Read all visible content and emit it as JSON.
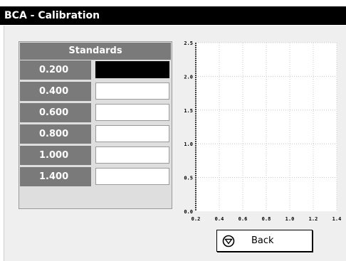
{
  "window": {
    "title": "BCA - Calibration"
  },
  "standards": {
    "header": "Standards",
    "rows": [
      {
        "label": "0.200",
        "value": "",
        "selected": true
      },
      {
        "label": "0.400",
        "value": "",
        "selected": false
      },
      {
        "label": "0.600",
        "value": "",
        "selected": false
      },
      {
        "label": "0.800",
        "value": "",
        "selected": false
      },
      {
        "label": "1.000",
        "value": "",
        "selected": false
      },
      {
        "label": "1.400",
        "value": "",
        "selected": false
      }
    ]
  },
  "chart_data": {
    "type": "scatter",
    "title": "",
    "xlabel": "",
    "ylabel": "",
    "xlim": [
      0.2,
      1.4
    ],
    "ylim": [
      0.0,
      2.5
    ],
    "x_tick_labels": [
      "0.2",
      "0.4",
      "0.6",
      "0.8",
      "1.0",
      "1.2",
      "1.4"
    ],
    "y_tick_labels": [
      "0.0",
      "0.5",
      "1.0",
      "1.5",
      "2.0",
      "2.5"
    ],
    "grid": true,
    "series": []
  },
  "actions": {
    "back_label": "Back",
    "back_icon": "circle-down-arrow-icon"
  }
}
